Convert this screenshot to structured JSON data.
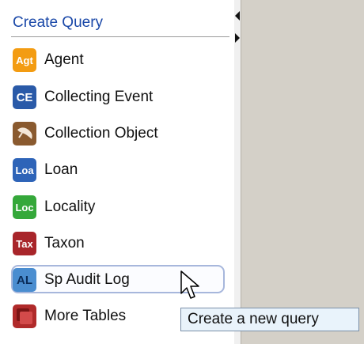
{
  "header": {
    "title": "Create Query"
  },
  "items": [
    {
      "label": "Agent",
      "icon": "agent-icon",
      "icon_text": "Agt",
      "color": "#f39c12"
    },
    {
      "label": "Collecting Event",
      "icon": "collecting-event-icon",
      "icon_text": "CE",
      "color": "#2a5aa8"
    },
    {
      "label": "Collection Object",
      "icon": "collection-object-icon",
      "icon_text": "",
      "color": "#8a5a2f"
    },
    {
      "label": "Loan",
      "icon": "loan-icon",
      "icon_text": "Loa",
      "color": "#2e64b8"
    },
    {
      "label": "Locality",
      "icon": "locality-icon",
      "icon_text": "Loc",
      "color": "#35a83a"
    },
    {
      "label": "Taxon",
      "icon": "taxon-icon",
      "icon_text": "Tax",
      "color": "#a8252a"
    },
    {
      "label": "Sp Audit Log",
      "icon": "sp-audit-log-icon",
      "icon_text": "AL",
      "color": "#4a8dd0"
    },
    {
      "label": "More Tables",
      "icon": "more-tables-icon",
      "icon_text": "",
      "color": "#b02a2a"
    }
  ],
  "tooltip": {
    "text": "Create a new query"
  }
}
